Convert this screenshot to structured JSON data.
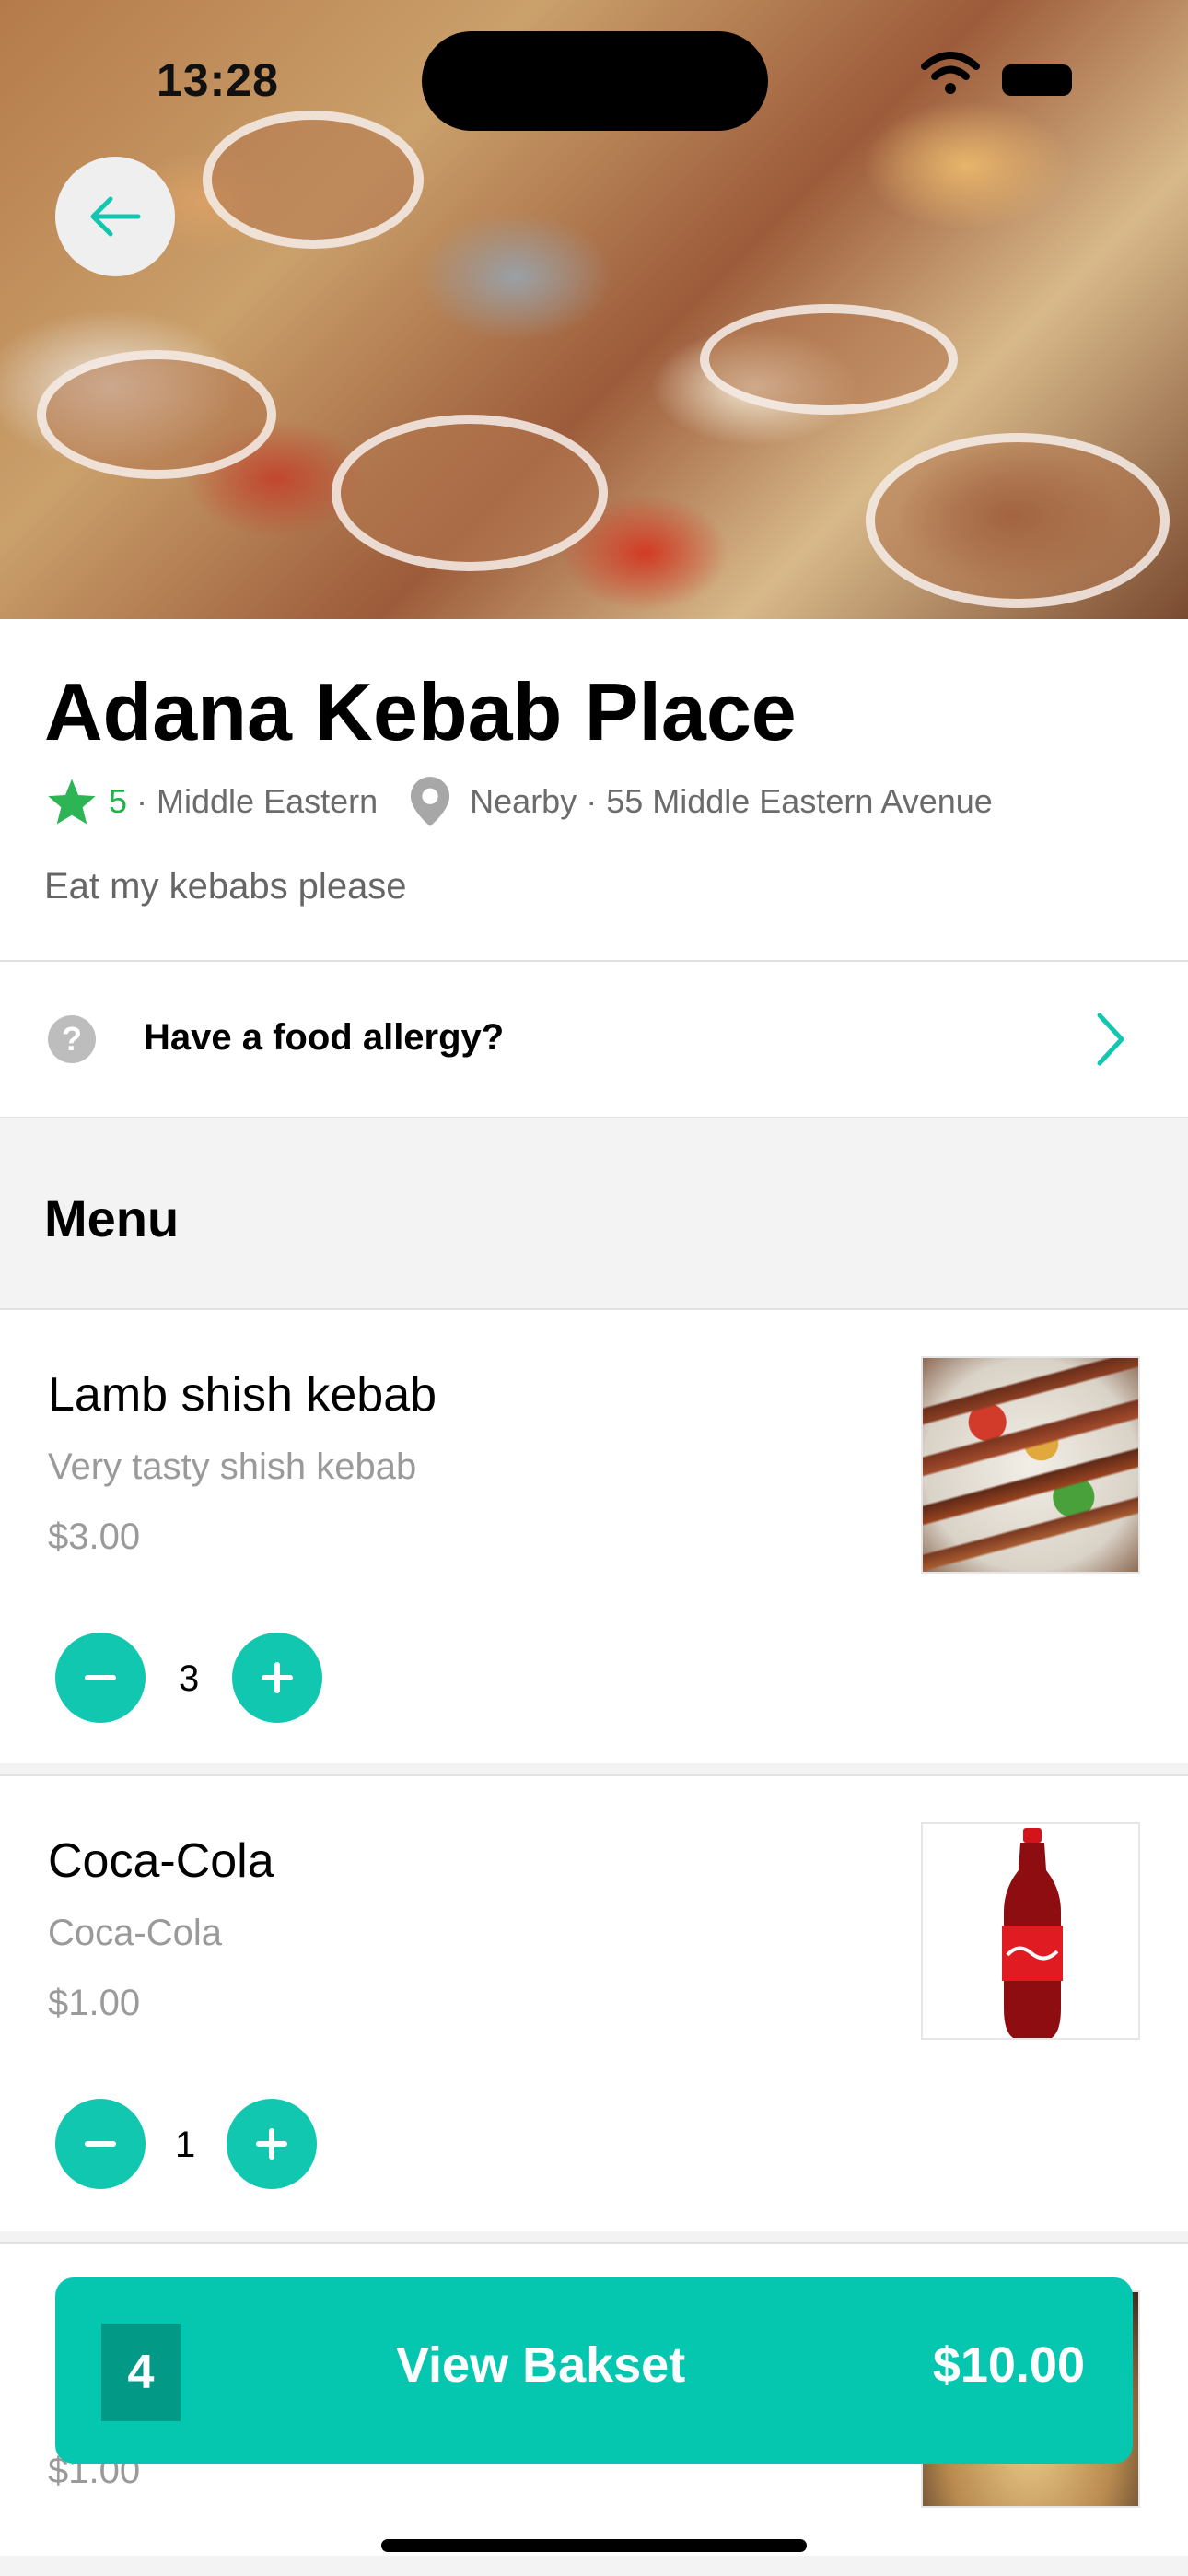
{
  "status_bar": {
    "time": "13:28"
  },
  "restaurant": {
    "name": "Adana Kebab Place",
    "rating": "5",
    "cuisine": "Middle Eastern",
    "location": "Nearby · 55 Middle Eastern Avenue",
    "description": "Eat my kebabs please"
  },
  "allergy": {
    "label": "Have a food allergy?"
  },
  "menu": {
    "heading": "Menu",
    "items": [
      {
        "name": "Lamb shish kebab",
        "description": "Very tasty shish kebab",
        "price": "$3.00",
        "quantity": "3",
        "image": "kebab-photo"
      },
      {
        "name": "Coca-Cola",
        "description": "Coca-Cola",
        "price": "$1.00",
        "quantity": "1",
        "image": "coca-cola-bottle-photo"
      },
      {
        "name": "",
        "description": "",
        "price": "$1.00",
        "image": "food-photo"
      }
    ]
  },
  "basket": {
    "count": "4",
    "label": "View Bakset",
    "total": "$10.00"
  },
  "colors": {
    "accent": "#05c7b0",
    "accent_dark": "#029a86",
    "rating": "#22b24c"
  },
  "icons": [
    "back-arrow-icon",
    "star-icon",
    "location-pin-icon",
    "question-icon",
    "chevron-right-icon",
    "minus-icon",
    "plus-icon",
    "wifi-icon",
    "battery-icon"
  ]
}
